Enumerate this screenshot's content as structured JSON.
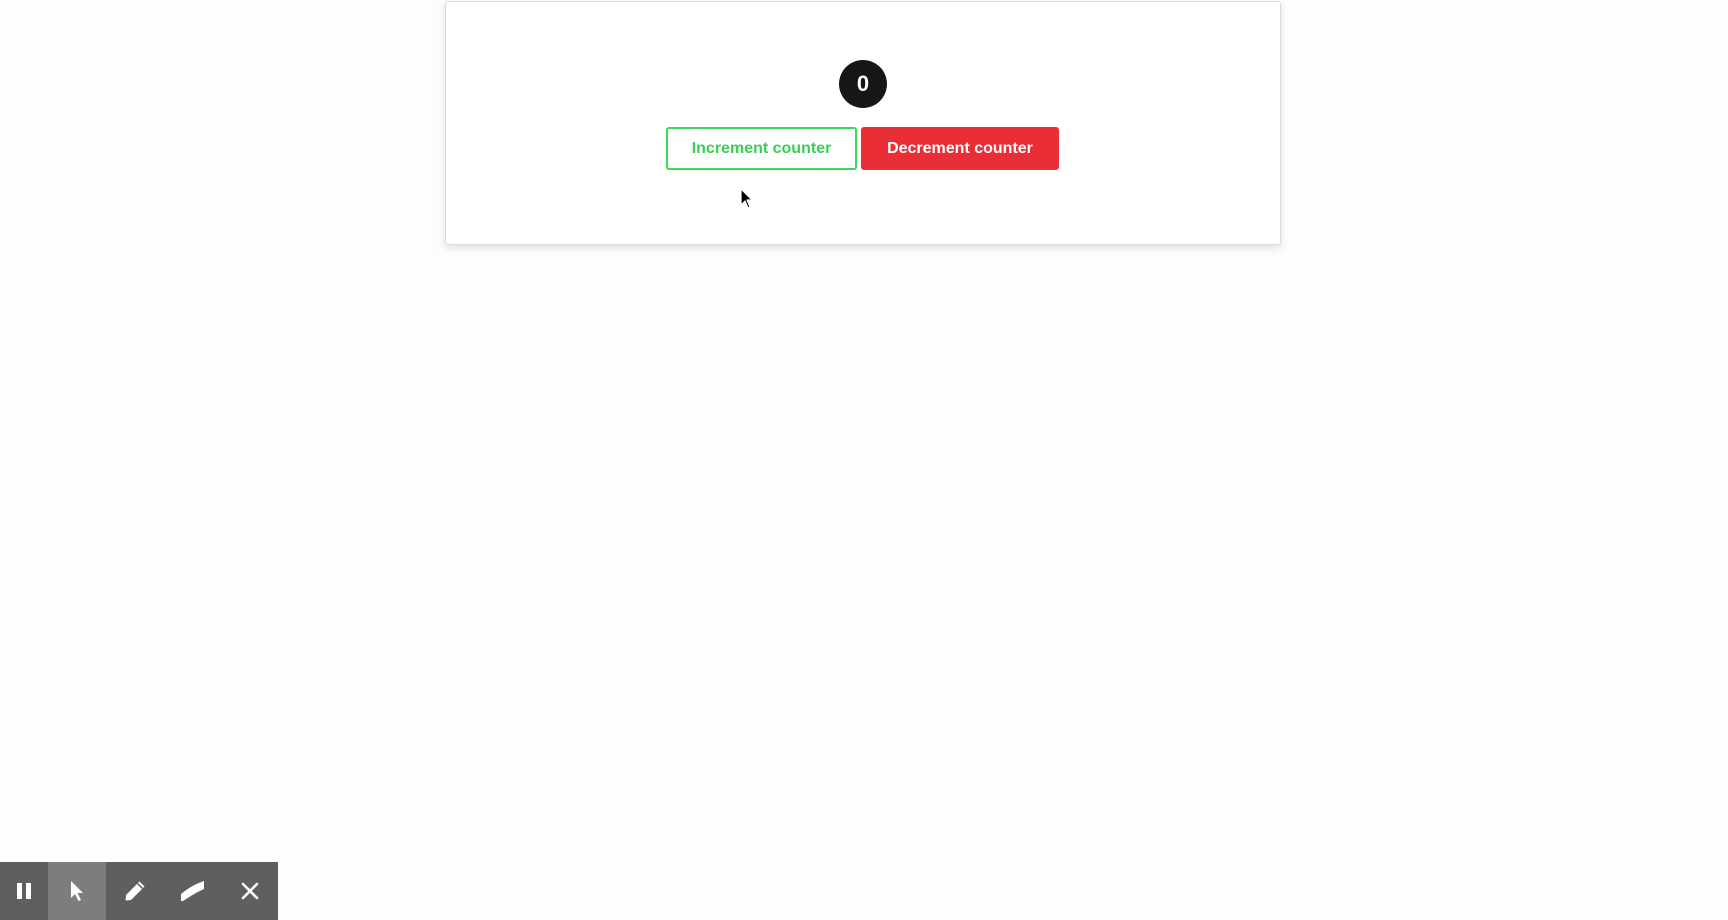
{
  "counter": {
    "value": "0"
  },
  "buttons": {
    "increment_label": "Increment counter",
    "decrement_label": "Decrement counter"
  },
  "colors": {
    "increment_accent": "#3dd75a",
    "decrement_accent": "#ea2e36",
    "badge_background": "#161616",
    "toolbar_background": "#5f5f5f",
    "toolbar_active": "#7d7d7d"
  },
  "toolbar": {
    "tools": [
      {
        "icon": "pause-icon",
        "active": false
      },
      {
        "icon": "pointer-icon",
        "active": true
      },
      {
        "icon": "pen-icon",
        "active": false
      },
      {
        "icon": "highlighter-icon",
        "active": false
      },
      {
        "icon": "close-icon",
        "active": false
      }
    ]
  }
}
